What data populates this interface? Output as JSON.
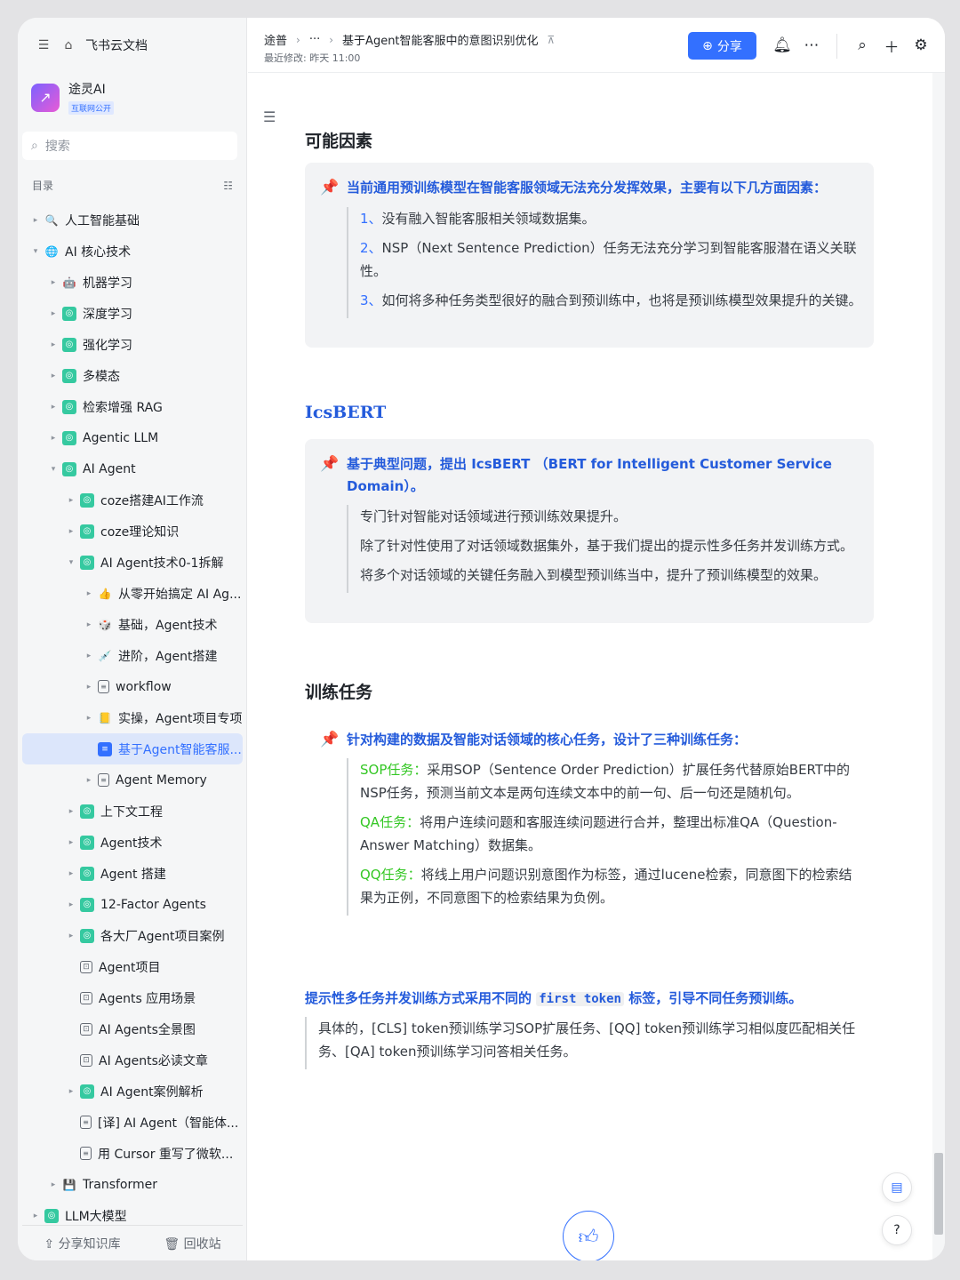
{
  "sidebar": {
    "app_title": "飞书云文档",
    "kb_name": "途灵AI",
    "kb_badge": "互联网公开",
    "search_placeholder": "搜索",
    "toc_label": "目录",
    "tree": [
      {
        "label": "人工智能基础",
        "depth": 0,
        "arrow": "▸",
        "icon": "magnifier-icon"
      },
      {
        "label": "AI 核心技术",
        "depth": 0,
        "arrow": "▾",
        "icon": "globe-icon"
      },
      {
        "label": "机器学习",
        "depth": 1,
        "arrow": "▸",
        "icon": "robot-icon"
      },
      {
        "label": "深度学习",
        "depth": 1,
        "arrow": "▸",
        "icon": "wiki-icon"
      },
      {
        "label": "强化学习",
        "depth": 1,
        "arrow": "▸",
        "icon": "wiki-icon"
      },
      {
        "label": "多模态",
        "depth": 1,
        "arrow": "▸",
        "icon": "wiki-icon"
      },
      {
        "label": "检索增强 RAG",
        "depth": 1,
        "arrow": "▸",
        "icon": "wiki-icon"
      },
      {
        "label": "Agentic LLM",
        "depth": 1,
        "arrow": "▸",
        "icon": "wiki-icon"
      },
      {
        "label": "AI Agent",
        "depth": 1,
        "arrow": "▾",
        "icon": "wiki-icon"
      },
      {
        "label": "coze搭建AI工作流",
        "depth": 2,
        "arrow": "▸",
        "icon": "wiki-icon"
      },
      {
        "label": "coze理论知识",
        "depth": 2,
        "arrow": "▸",
        "icon": "wiki-icon"
      },
      {
        "label": "AI Agent技术0-1拆解",
        "depth": 2,
        "arrow": "▾",
        "icon": "wiki-icon"
      },
      {
        "label": "从零开始搞定 AI Ag...",
        "depth": 3,
        "arrow": "▸",
        "icon": "hand-icon"
      },
      {
        "label": "基础，Agent技术",
        "depth": 3,
        "arrow": "▸",
        "icon": "dice-icon"
      },
      {
        "label": "进阶，Agent搭建",
        "depth": 3,
        "arrow": "▸",
        "icon": "syringe-icon"
      },
      {
        "label": "workflow",
        "depth": 3,
        "arrow": "▸",
        "icon": "doc-icon"
      },
      {
        "label": "实操，Agent项目专项",
        "depth": 3,
        "arrow": "▸",
        "icon": "folder-icon"
      },
      {
        "label": "基于Agent智能客服...",
        "depth": 3,
        "arrow": "",
        "icon": "bluedoc-icon",
        "selected": true
      },
      {
        "label": "Agent Memory",
        "depth": 3,
        "arrow": "▸",
        "icon": "doc-icon"
      },
      {
        "label": "上下文工程",
        "depth": 2,
        "arrow": "▸",
        "icon": "wiki-icon"
      },
      {
        "label": "Agent技术",
        "depth": 2,
        "arrow": "▸",
        "icon": "wiki-icon"
      },
      {
        "label": "Agent 搭建",
        "depth": 2,
        "arrow": "▸",
        "icon": "wiki-icon"
      },
      {
        "label": "12-Factor Agents",
        "depth": 2,
        "arrow": "▸",
        "icon": "wiki-icon"
      },
      {
        "label": "各大厂Agent项目案例",
        "depth": 2,
        "arrow": "▸",
        "icon": "wiki-icon"
      },
      {
        "label": "Agent项目",
        "depth": 2,
        "arrow": "",
        "icon": "mindnote-icon"
      },
      {
        "label": "Agents 应用场景",
        "depth": 2,
        "arrow": "",
        "icon": "mindnote-icon"
      },
      {
        "label": "AI Agents全景图",
        "depth": 2,
        "arrow": "",
        "icon": "mindnote-icon"
      },
      {
        "label": "AI Agents必读文章",
        "depth": 2,
        "arrow": "",
        "icon": "mindnote-icon"
      },
      {
        "label": "AI Agent案例解析",
        "depth": 2,
        "arrow": "▸",
        "icon": "wiki-icon"
      },
      {
        "label": "[译] AI Agent（智能体...",
        "depth": 2,
        "arrow": "",
        "icon": "doc-icon"
      },
      {
        "label": "用 Cursor 重写了微软...",
        "depth": 2,
        "arrow": "",
        "icon": "doc-icon"
      },
      {
        "label": "Transformer",
        "depth": 1,
        "arrow": "▸",
        "icon": "floppy-icon"
      },
      {
        "label": "LLM大模型",
        "depth": 0,
        "arrow": "▸",
        "icon": "wiki-icon"
      }
    ],
    "footer_share": "分享知识库",
    "footer_trash": "回收站"
  },
  "header": {
    "crumb_root": "途普",
    "crumb_more": "···",
    "crumb_current": "基于Agent智能客服中的意图识别优化",
    "modified": "最近修改: 昨天 11:00",
    "share_label": "分享"
  },
  "doc": {
    "s1_title": "可能因素",
    "s1_callout_title": "当前通用预训练模型在智能客服领域无法充分发挥效果，主要有以下几方面因素：",
    "s1_items": [
      {
        "num": "1、",
        "text": "没有融入智能客服相关领域数据集。"
      },
      {
        "num": "2、",
        "text": "NSP（Next Sentence Prediction）任务无法充分学习到智能客服潜在语义关联性。"
      },
      {
        "num": "3、",
        "text": "如何将多种任务类型很好的融合到预训练中，也将是预训练模型效果提升的关键。"
      }
    ],
    "s2_title": "IcsBERT",
    "s2_callout_title": "基于典型问题，提出 IcsBERT （BERT for Intelligent Customer Service Domain）。",
    "s2_items": [
      "专门针对智能对话领域进行预训练效果提升。",
      "除了针对性使用了对话领域数据集外，基于我们提出的提示性多任务并发训练方式。",
      "将多个对话领域的关键任务融入到模型预训练当中，提升了预训练模型的效果。"
    ],
    "s3_title": "训练任务",
    "s3_callout_title": "针对构建的数据及智能对话领域的核心任务，设计了三种训练任务：",
    "s3_items": [
      {
        "tag": "SOP任务：",
        "text": "采用SOP（Sentence Order Prediction）扩展任务代替原始BERT中的NSP任务，预测当前文本是两句连续文本中的前一句、后一句还是随机句。"
      },
      {
        "tag": "QA任务：",
        "text": "将用户连续问题和客服连续问题进行合并，整理出标准QA（Question-Answer Matching）数据集。"
      },
      {
        "tag": "QQ任务：",
        "text": "将线上用户问题识别意图作为标签，通过lucene检索，同意图下的检索结果为正例，不同意图下的检索结果为负例。"
      }
    ],
    "s4_title_pre": "提示性多任务并发训练方式采用不同的",
    "s4_code": "first token",
    "s4_title_post": "标签，引导不同任务预训练。",
    "s4_quote": "具体的，[CLS] token预训练学习SOP扩展任务、[QQ] token预训练学习相似度匹配相关任务、[QA] token预训练学习问答相关任务。"
  },
  "colors": {
    "accent": "#3370ff",
    "heading_blue": "#245bdb",
    "green": "#34c724",
    "pin": "#f54a45"
  }
}
